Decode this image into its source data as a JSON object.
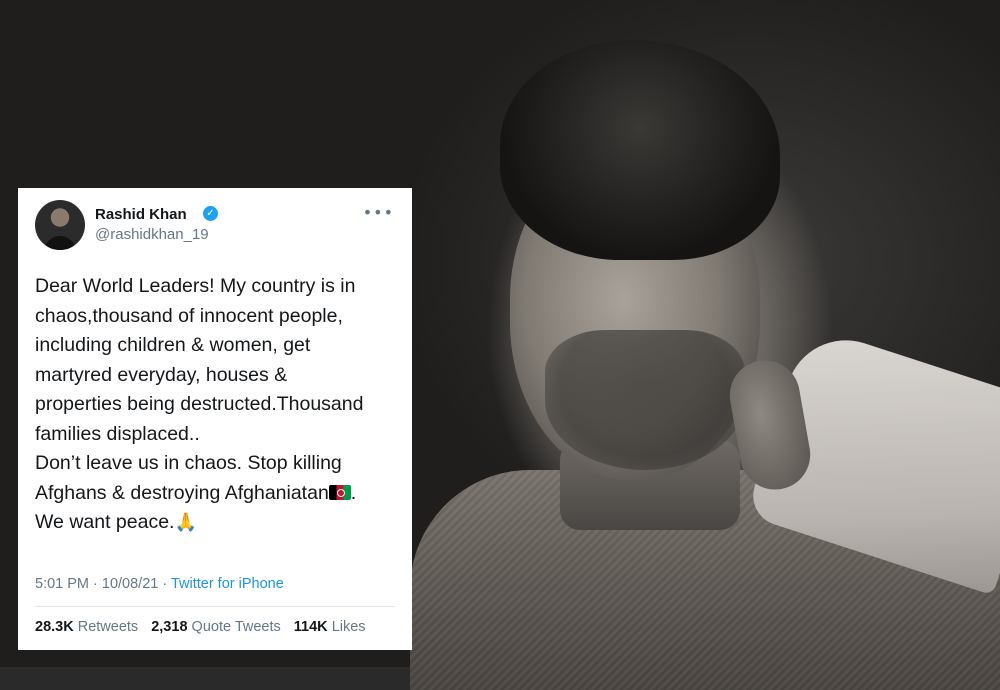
{
  "tweet": {
    "author_name": "Rashid Khan",
    "author_handle": "@rashidkhan_19",
    "verified_icon": "verified-badge-icon",
    "more_icon": "more-options-icon",
    "more_glyph": "•••",
    "body_lines": [
      "Dear World Leaders! My country is in",
      "chaos,thousand of innocent people,",
      "including children & women, get",
      "martyred everyday, houses &",
      "properties being destructed.Thousand",
      "families displaced..",
      "Don’t leave us in chaos. Stop killing",
      "Afghans & destroying Afghaniatan",
      "We want peace."
    ],
    "line8_suffix": ".",
    "flag_emoji": "afghanistan-flag-icon",
    "pray_emoji": "🙏",
    "time": "5:01 PM · 10/08/21 · ",
    "source": "Twitter for iPhone",
    "retweets_count": "28.3K",
    "retweets_label": "Retweets",
    "quotes_count": "2,318",
    "quotes_label": "Quote Tweets",
    "likes_count": "114K",
    "likes_label": "Likes"
  },
  "colors": {
    "link": "#1b95e0",
    "verified": "#1da1f2",
    "muted": "#657786",
    "text": "#14171a"
  }
}
